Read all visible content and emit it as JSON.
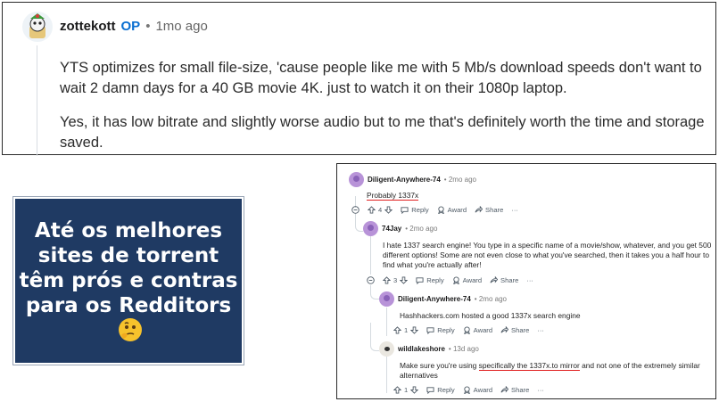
{
  "top_comment": {
    "username": "zottekott",
    "op_badge": "OP",
    "separator": "•",
    "time": "1mo ago",
    "paragraph1": "YTS optimizes for small file-size, 'cause people like me with 5 Mb/s download speeds don't want to wait 2 damn days for a 40 GB movie 4K. just to watch it on their 1080p laptop.",
    "paragraph2": "Yes, it has low bitrate and slightly worse audio but to me that's definitely worth the time and storage saved."
  },
  "banner": {
    "text": "Até os melhores sites de torrent têm prós e contras para os Redditors",
    "color": "#1f3a63"
  },
  "thread": {
    "reply_label": "Reply",
    "award_label": "Award",
    "share_label": "Share",
    "more_label": "···",
    "comments": [
      {
        "username": "Diligent-Anywhere-74",
        "time": "2mo ago",
        "text": "Probably 1337x",
        "votes": "4"
      },
      {
        "username": "74Jay",
        "time": "2mo ago",
        "text": "I hate 1337 search engine! You type in a specific name of a movie/show, whatever, and you get 500 different options! Some are not even close to what you've searched, then it takes you a half hour to find what you're actually after!",
        "votes": "3"
      },
      {
        "username": "Diligent-Anywhere-74",
        "time": "2mo ago",
        "text": "Hashhackers.com hosted a good 1337x search engine",
        "votes": "1"
      },
      {
        "username": "wildlakeshore",
        "time": "13d ago",
        "text_before": "Make sure you're using ",
        "text_highlight": "specifically the 1337x.to mirror",
        "text_after": " and not one of the extremely similar alternatives",
        "votes": "1"
      }
    ]
  },
  "colors": {
    "op_blue": "#0a6fd1",
    "underline_red": "#e01e1e"
  }
}
